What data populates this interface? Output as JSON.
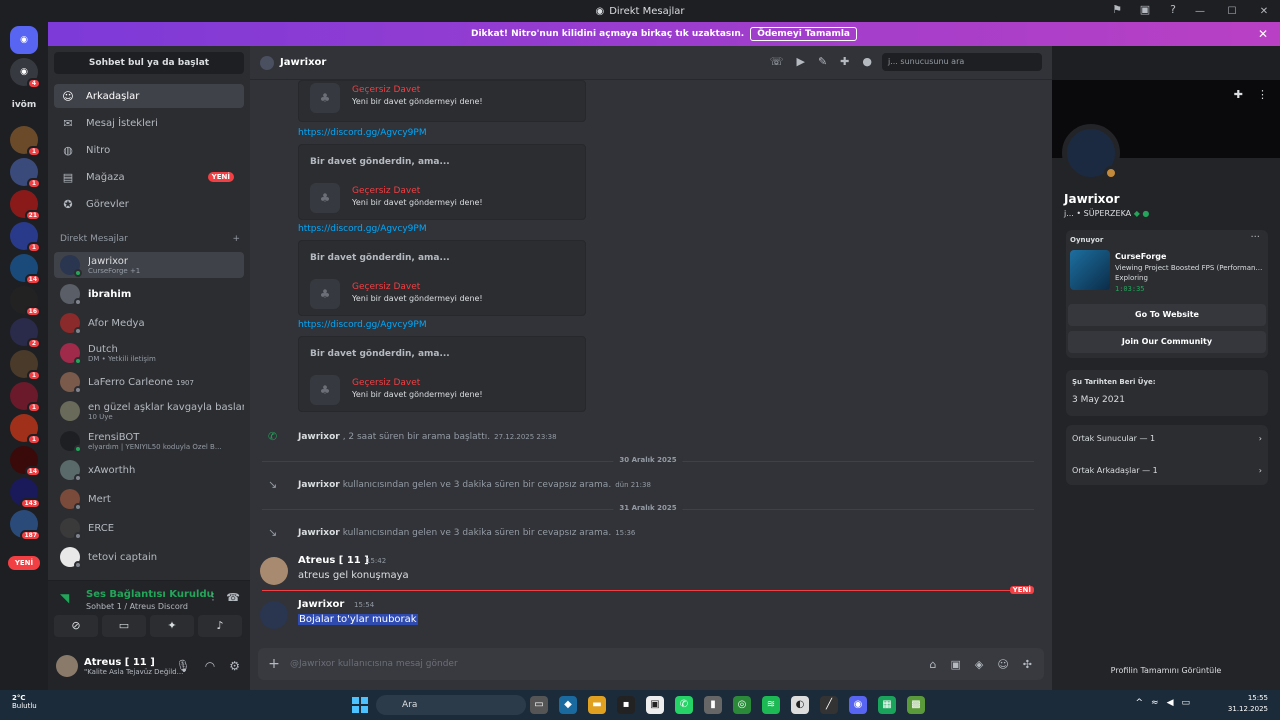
{
  "window": {
    "title": "Direkt Mesajlar"
  },
  "banner": {
    "text": "Dikkat! Nitro'nun kilidini açmaya birkaç tık uzaktasın.",
    "button": "Ödemeyi Tamamla"
  },
  "servers": {
    "label": "ivöm",
    "badges": [
      "4",
      "1",
      "1",
      "21",
      "1",
      "14",
      "16",
      "2",
      "1",
      "1",
      "14",
      "143",
      "187"
    ],
    "new_label": "YENİ"
  },
  "sidebar": {
    "search": "Sohbet bul ya da başlat",
    "nav": [
      {
        "label": "Arkadaşlar",
        "icon": "friends-icon"
      },
      {
        "label": "Mesaj İstekleri",
        "icon": "mail-icon"
      },
      {
        "label": "Nitro",
        "icon": "nitro-icon"
      },
      {
        "label": "Mağaza",
        "icon": "shop-icon",
        "badge": "YENİ"
      },
      {
        "label": "Görevler",
        "icon": "quests-icon"
      }
    ],
    "dm_header": "Direkt Mesajlar",
    "dms": [
      {
        "name": "Jawrixor",
        "sub": "CurseForge +1"
      },
      {
        "name": "ibrahim",
        "sub": ""
      },
      {
        "name": "Afor Medya",
        "sub": ""
      },
      {
        "name": "Dutch",
        "sub": "DM • Yetkili iletişim"
      },
      {
        "name": "LaFerro Carleone",
        "sub": "1907"
      },
      {
        "name": "en güzel aşklar kavgayla baslar",
        "sub": "10 Üye"
      },
      {
        "name": "ErensiBOT",
        "sub": "elyardım | YENIYIL50 koduyla Özel B..."
      },
      {
        "name": "xAworthh",
        "sub": ""
      },
      {
        "name": "Mert",
        "sub": ""
      },
      {
        "name": "ERCE",
        "sub": ""
      },
      {
        "name": "tetovi captain",
        "sub": ""
      }
    ]
  },
  "voice": {
    "title": "Ses Bağlantısı Kuruldu",
    "sub": "Sohbet 1 / Atreus Discord"
  },
  "user": {
    "name": "Atreus [ 11 ]",
    "status": "\"Kalite Asla Tejavüz Değild..."
  },
  "chat": {
    "header_name": "Jawrixor",
    "search_placeholder": "j... sunucusunu ara",
    "invite_title": "Bir davet gönderdin, ama...",
    "invite_name": "Geçersiz Davet",
    "invite_desc": "Yeni bir davet göndermeyi dene!",
    "link": "https://discord.gg/Agvcy9PM",
    "call": {
      "who": "Jawrixor",
      "text": ", 2 saat süren bir arama başlattı.",
      "time": "27.12.2025 23:38"
    },
    "date1": "30 Aralık 2025",
    "missed1": {
      "who": "Jawrixor",
      "text": "kullanıcısından gelen ve 3 dakika süren bir cevapsız arama.",
      "time": "dün 21:38"
    },
    "date2": "31 Aralık 2025",
    "missed2": {
      "who": "Jawrixor",
      "text": "kullanıcısından gelen ve 3 dakika süren bir cevapsız arama.",
      "time": "15:36"
    },
    "msg1": {
      "author": "Atreus [ 11 ]",
      "time": "15:42",
      "text": "atreus gel konuşmaya"
    },
    "new_label": "YENİ",
    "msg2": {
      "author": "Jawrixor",
      "time": "15:54",
      "text": "Bojalar to'ylar muborak"
    },
    "composer_placeholder": "@Jawrixor kullanıcısına mesaj gönder"
  },
  "profile": {
    "name": "Jawrixor",
    "tag": "j... • SÜPERZEKA",
    "activity_header": "Oynuyor",
    "game": "CurseForge",
    "detail": "Viewing Project Boosted FPS (Performanc...",
    "state": "Exploring",
    "elapsed": "1:03:35",
    "btn1": "Go To Website",
    "btn2": "Join Our Community",
    "member_label": "Şu Tarihten Beri Üye:",
    "member_date": "3 May 2021",
    "mutual_servers": "Ortak Sunucular — 1",
    "mutual_friends": "Ortak Arkadaşlar — 1",
    "footer": "Profilin Tamamını Görüntüle"
  },
  "taskbar": {
    "temp": "2°C",
    "weather": "Bulutlu",
    "search": "Ara",
    "time": "15:55",
    "date": "31.12.2025"
  }
}
